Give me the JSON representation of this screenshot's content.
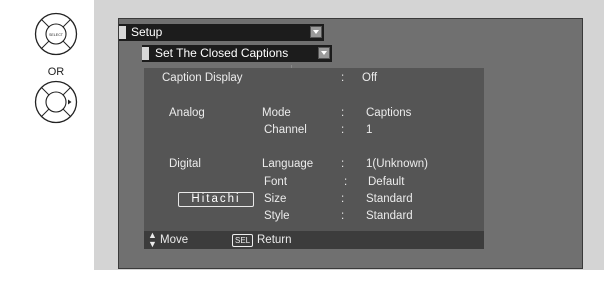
{
  "remote": {
    "select_button_text": "SELECT",
    "or_label": "OR"
  },
  "menu": {
    "setup_title": "Setup",
    "submenu_title": "Set  The Closed Captions"
  },
  "settings": {
    "caption_display": {
      "label": "Caption Display",
      "sep": ":",
      "value": "Off"
    },
    "analog": {
      "group_label": "Analog",
      "mode": {
        "label": "Mode",
        "sep": ":",
        "value": "Captions"
      },
      "channel": {
        "label": "Channel",
        "sep": ":",
        "value": "1"
      }
    },
    "digital": {
      "group_label": "Digital",
      "language": {
        "label": "Language",
        "sep": ":",
        "value": "1(Unknown)"
      },
      "font": {
        "label": "Font",
        "sep": ":",
        "value": "Default"
      },
      "size": {
        "label": "Size",
        "sep": ":",
        "value": "Standard"
      },
      "style": {
        "label": "Style",
        "sep": ":",
        "value": "Standard"
      }
    }
  },
  "brand_badge": "Hitachi",
  "footer": {
    "updown_icon": "↕",
    "move_label": "Move",
    "sel_key": "SEL",
    "return_label": "Return"
  },
  "icons": {
    "select_button": "select-button-icon",
    "direction_button": "direction-pad-icon",
    "dropdown_arrow": "dropdown-arrow-icon"
  }
}
